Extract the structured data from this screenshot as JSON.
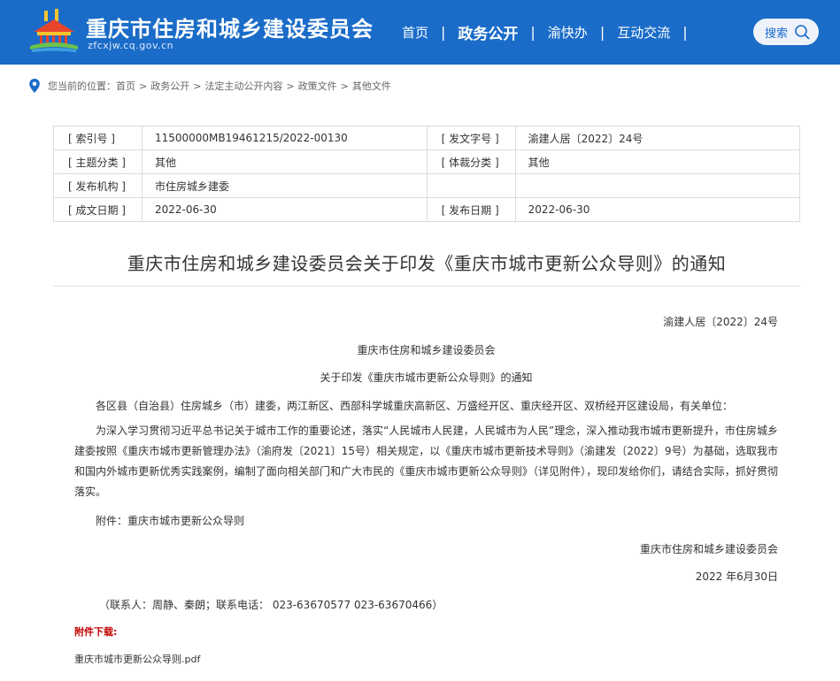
{
  "header": {
    "site_title": "重庆市住房和城乡建设委员会",
    "site_domain": "zfcxjw.cq.gov.cn",
    "nav": [
      {
        "label": "首页"
      },
      {
        "label": "政务公开"
      },
      {
        "label": "渝快办"
      },
      {
        "label": "互动交流"
      }
    ],
    "nav_separator": "|",
    "search_label": "搜索"
  },
  "breadcrumb": {
    "prefix": "您当前的位置：",
    "items": [
      "首页",
      "政务公开",
      "法定主动公开内容",
      "政策文件",
      "其他文件"
    ],
    "separator": ">"
  },
  "meta": {
    "rows": [
      {
        "l1": "[ 索引号 ]",
        "v1": "11500000MB19461215/2022-00130",
        "l2": "[ 发文字号 ]",
        "v2": "渝建人居〔2022〕24号"
      },
      {
        "l1": "[ 主题分类 ]",
        "v1": "其他",
        "l2": "[ 体裁分类 ]",
        "v2": "其他"
      },
      {
        "l1": "[ 发布机构 ]",
        "v1": "市住房城乡建委",
        "l2": "",
        "v2": ""
      },
      {
        "l1": "[ 成文日期 ]",
        "v1": "2022-06-30",
        "l2": "[ 发布日期 ]",
        "v2": "2022-06-30"
      }
    ]
  },
  "doc": {
    "title": "重庆市住房和城乡建设委员会关于印发《重庆市城市更新公众导则》的通知",
    "doc_number": "渝建人居〔2022〕24号",
    "issuer_line": "重庆市住房和城乡建设委员会",
    "subject_line": "关于印发《重庆市城市更新公众导则》的通知",
    "addressee": "各区县（自治县）住房城乡（市）建委，两江新区、西部科学城重庆高新区、万盛经开区、重庆经开区、双桥经开区建设局，有关单位：",
    "body": "为深入学习贯彻习近平总书记关于城市工作的重要论述，落实“人民城市人民建，人民城市为人民”理念，深入推动我市城市更新提升，市住房城乡建委按照《重庆市城市更新管理办法》（渝府发〔2021〕15号）相关规定，以《重庆市城市更新技术导则》（渝建发〔2022〕9号）为基础，选取我市和国内外城市更新优秀实践案例，编制了面向相关部门和广大市民的《重庆市城市更新公众导则》（详见附件），现印发给你们，请结合实际，抓好贯彻落实。",
    "attachment_line": "附件：重庆市城市更新公众导则",
    "signature": "重庆市住房和城乡建设委员会",
    "date": "2022 年6月30日",
    "contact": "（联系人：周静、秦朗；联系电话： 023-63670577   023-63670466）"
  },
  "attachments": {
    "heading": "附件下载:",
    "files": [
      "重庆市城市更新公众导则.pdf"
    ]
  },
  "colors": {
    "header_bg": "#1a6cc8",
    "attachment_heading": "#c00000"
  }
}
